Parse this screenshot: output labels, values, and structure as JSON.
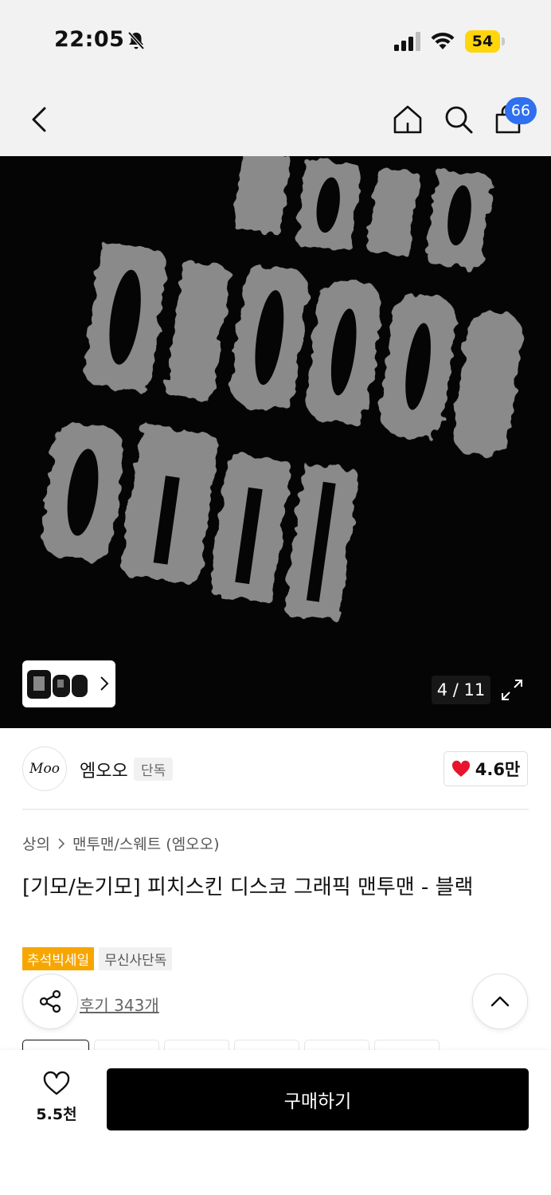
{
  "status_bar": {
    "time": "22:05",
    "battery": "54"
  },
  "nav": {
    "cart_count": "66"
  },
  "gallery": {
    "counter": "4 / 11",
    "current": 4,
    "total": 11
  },
  "brand": {
    "logo_text": "Moo",
    "name": "엠오오",
    "tag": "단독",
    "likes": "4.6만"
  },
  "breadcrumb": {
    "items": [
      "상의",
      "맨투맨/스웨트 (엠오오)"
    ]
  },
  "product": {
    "title": "[기모/논기모] 피치스킨 디스코 그래픽 맨투맨 - 블랙",
    "tags": [
      "추석빅세일",
      "무신사단독"
    ],
    "review_link": "후기 343개"
  },
  "bottom_bar": {
    "wish_count": "5.5천",
    "buy_label": "구매하기"
  },
  "colors": {
    "accent_badge": "#2f6ff0",
    "sale_tag": "#f7a600",
    "heart": "#e8142d",
    "buy_button": "#000000"
  },
  "icons": [
    "bell-muted-icon",
    "signal-icon",
    "wifi-icon",
    "battery-icon",
    "back-arrow-icon",
    "home-icon",
    "search-icon",
    "cart-icon",
    "chevron-right-icon",
    "expand-icon",
    "heart-filled-icon",
    "share-icon",
    "chevron-up-icon",
    "heart-outline-icon"
  ]
}
